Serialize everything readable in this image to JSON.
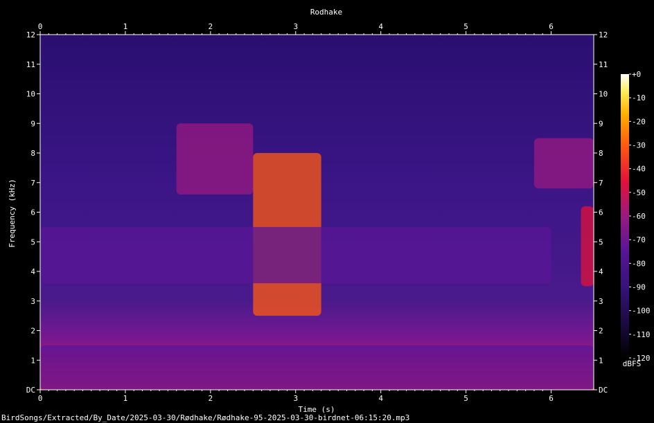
{
  "chart_data": {
    "type": "heatmap",
    "title": "Rodhake",
    "xlabel": "Time (s)",
    "ylabel": "Frequency (kHz)",
    "x_range": [
      0,
      6.5
    ],
    "y_range": [
      0,
      12
    ],
    "x_ticks": [
      "0",
      "1",
      "2",
      "3",
      "4",
      "5",
      "6"
    ],
    "y_ticks": [
      "DC",
      "1",
      "2",
      "3",
      "4",
      "5",
      "6",
      "7",
      "8",
      "9",
      "10",
      "11",
      "12"
    ],
    "colorbar": {
      "unit": "dBFS",
      "ticks": [
        "+0",
        "-10",
        "-20",
        "-30",
        "-40",
        "-50",
        "-60",
        "-70",
        "-80",
        "-90",
        "-100",
        "-110",
        "-120"
      ],
      "range": [
        -120,
        0
      ],
      "colormap": "black-purple-red-orange-yellow-white"
    },
    "background_level_dbfs": -95,
    "energy_regions": [
      {
        "t": [
          1.6,
          2.5
        ],
        "f": [
          6.6,
          9.0
        ],
        "level_dbfs": -50
      },
      {
        "t": [
          2.5,
          3.3
        ],
        "f": [
          2.5,
          8.0
        ],
        "level_dbfs": -25
      },
      {
        "t": [
          0.0,
          6.5
        ],
        "f": [
          0.0,
          1.5
        ],
        "level_dbfs": -65
      },
      {
        "t": [
          5.8,
          6.5
        ],
        "f": [
          6.8,
          8.5
        ],
        "level_dbfs": -50
      },
      {
        "t": [
          6.35,
          6.5
        ],
        "f": [
          3.5,
          6.2
        ],
        "level_dbfs": -35
      },
      {
        "t": [
          0.0,
          6.0
        ],
        "f": [
          3.6,
          5.5
        ],
        "level_dbfs": -72
      }
    ]
  },
  "footer": "BirdSongs/Extracted/By_Date/2025-03-30/Rødhake/Rødhake-95-2025-03-30-birdnet-06:15:20.mp3"
}
